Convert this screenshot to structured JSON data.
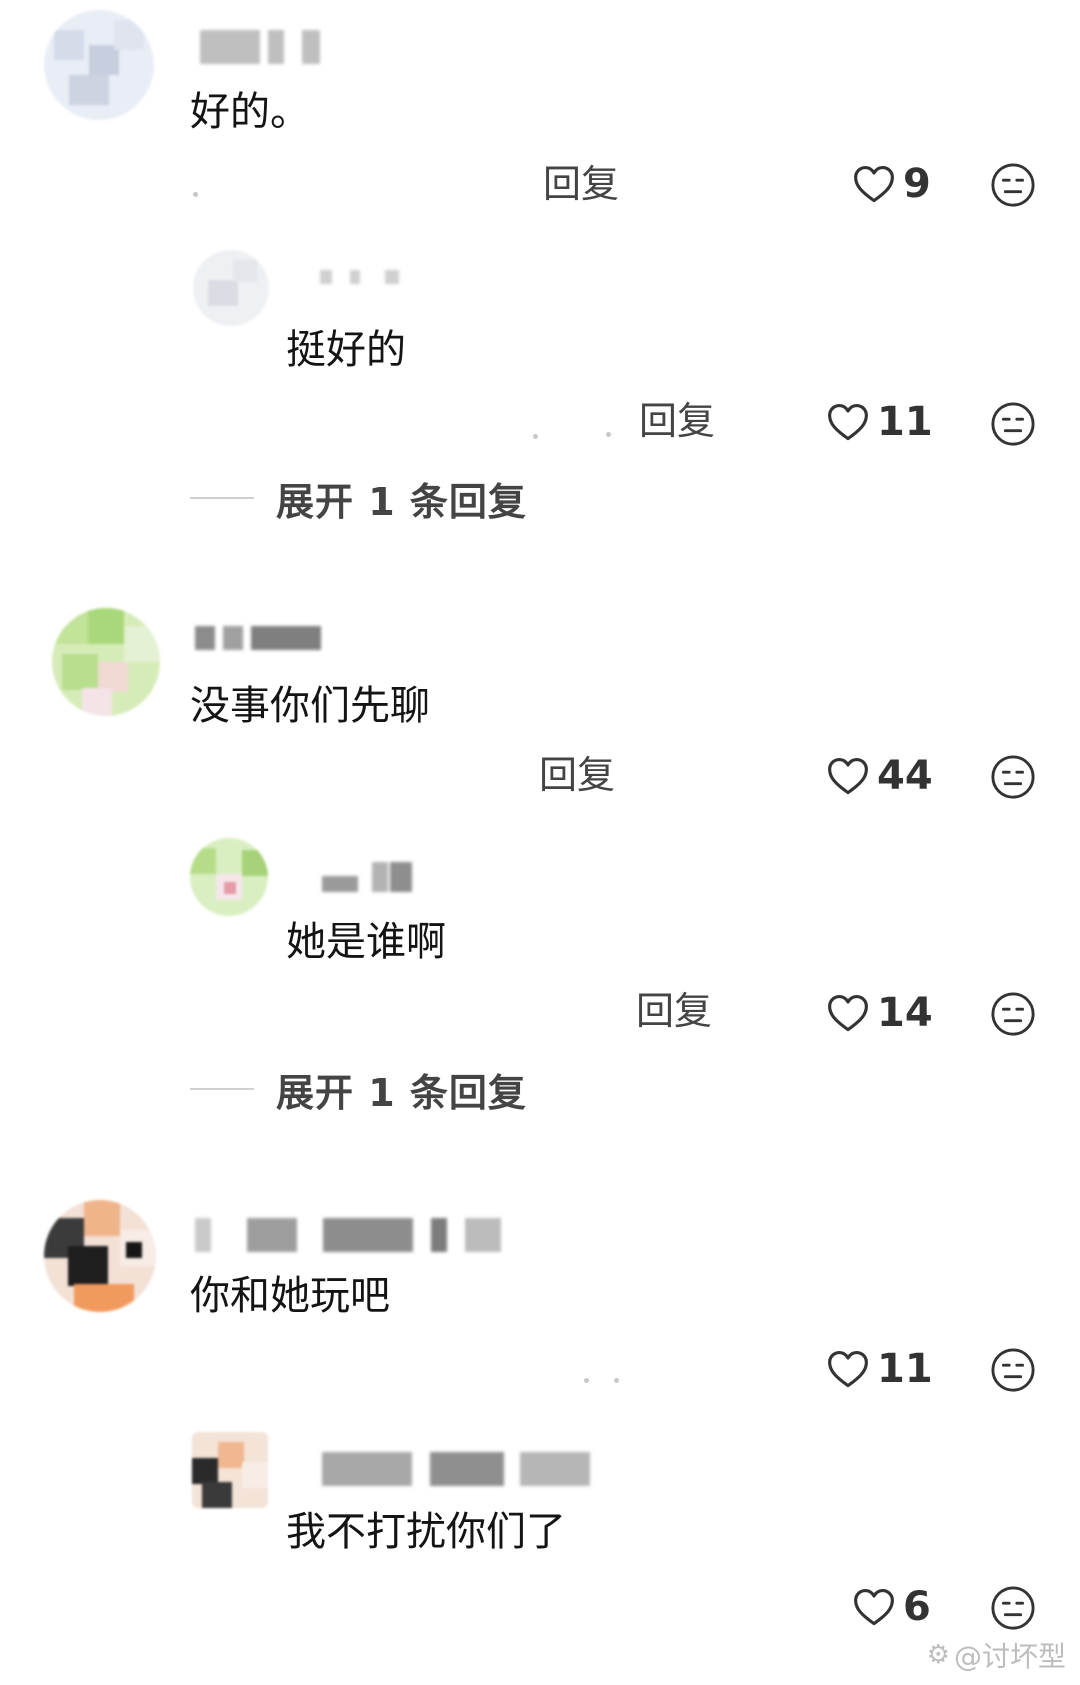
{
  "comments": [
    {
      "text": "好的。",
      "reply_label": "回复",
      "likes": "9",
      "reply": {
        "text": "挺好的",
        "reply_label": "回复",
        "likes": "11"
      },
      "expand_label": "展开 1 条回复"
    },
    {
      "text": "没事你们先聊",
      "reply_label": "回复",
      "likes": "44",
      "reply": {
        "text": "她是谁啊",
        "reply_label": "回复",
        "likes": "14"
      },
      "expand_label": "展开 1 条回复"
    },
    {
      "text": "你和她玩吧",
      "likes": "11",
      "reply": {
        "text": "我不打扰你们了",
        "likes": "6"
      }
    }
  ],
  "watermark": {
    "text": "@讨坏型"
  },
  "icons": {
    "like": "heart-outline-icon",
    "dislike": "neutral-face-icon",
    "watermark_logo": "weibo-logo-icon"
  },
  "colors": {
    "text": "#141414",
    "muted": "#444444",
    "divider": "#d0d0d0",
    "watermark": "#bdbdbd"
  }
}
